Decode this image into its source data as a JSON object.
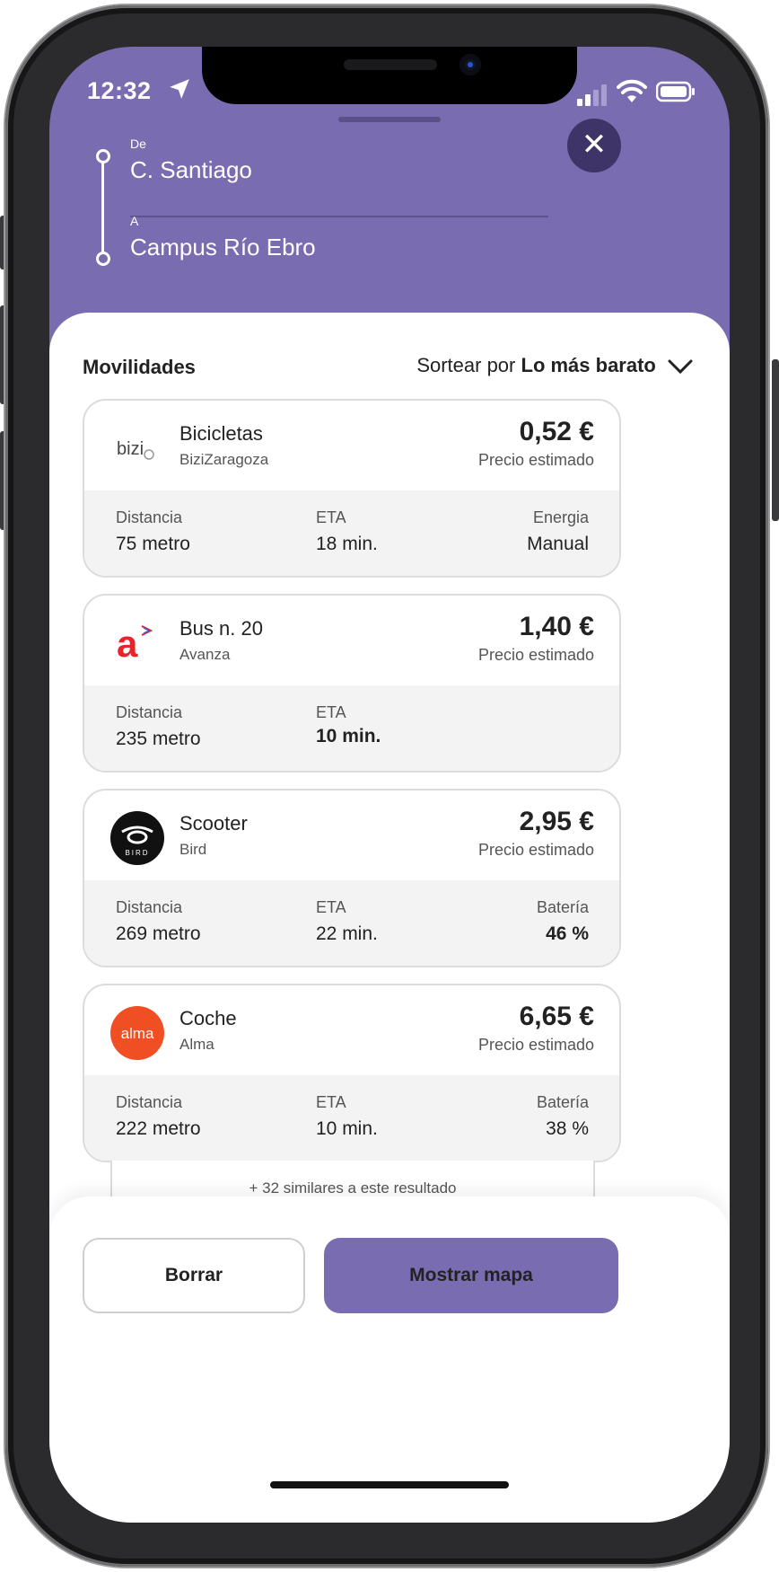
{
  "status": {
    "time": "12:32"
  },
  "route": {
    "from_label": "De",
    "from_value": "C. Santiago",
    "to_label": "A",
    "to_value": "Campus Río Ebro"
  },
  "header_icons": {
    "close": "close-icon",
    "location": "location-arrow-icon"
  },
  "list": {
    "title": "Movilidades",
    "sort_prefix": "Sortear por",
    "sort_value": "Lo más barato"
  },
  "cards": [
    {
      "name": "Bicicletas",
      "provider": "BiziZaragoza",
      "logo_text": "bizi",
      "price": "0,52 €",
      "price_note": "Precio estimado",
      "d1_label": "Distancia",
      "d1_value": "75 metro",
      "d2_label": "ETA",
      "d2_value": "18 min.",
      "d3_label": "Energia",
      "d3_value": "Manual"
    },
    {
      "name": "Bus n. 20",
      "provider": "Avanza",
      "logo_text": "a",
      "price": "1,40 €",
      "price_note": "Precio estimado",
      "d1_label": "Distancia",
      "d1_value": "235 metro",
      "d2_label": "ETA",
      "d2_value": "10 min."
    },
    {
      "name": "Scooter",
      "provider": "Bird",
      "logo_text": "BIRD",
      "price": "2,95 €",
      "price_note": "Precio estimado",
      "d1_label": "Distancia",
      "d1_value": "269 metro",
      "d2_label": "ETA",
      "d2_value": "22 min.",
      "d3_label": "Batería",
      "d3_value": "46 %"
    },
    {
      "name": "Coche",
      "provider": "Alma",
      "logo_text": "alma",
      "price": "6,65 €",
      "price_note": "Precio estimado",
      "d1_label": "Distancia",
      "d1_value": "222 metro",
      "d2_label": "ETA",
      "d2_value": "10 min.",
      "d3_label": "Batería",
      "d3_value": "38 %"
    }
  ],
  "similar": "+ 32 similares a este resultado",
  "buttons": {
    "clear": "Borrar",
    "map": "Mostrar mapa"
  },
  "colors": {
    "accent": "#7a6cb0",
    "close_bg": "#3f3467",
    "avanza_red": "#e8232a",
    "alma_orange": "#f04e23"
  }
}
